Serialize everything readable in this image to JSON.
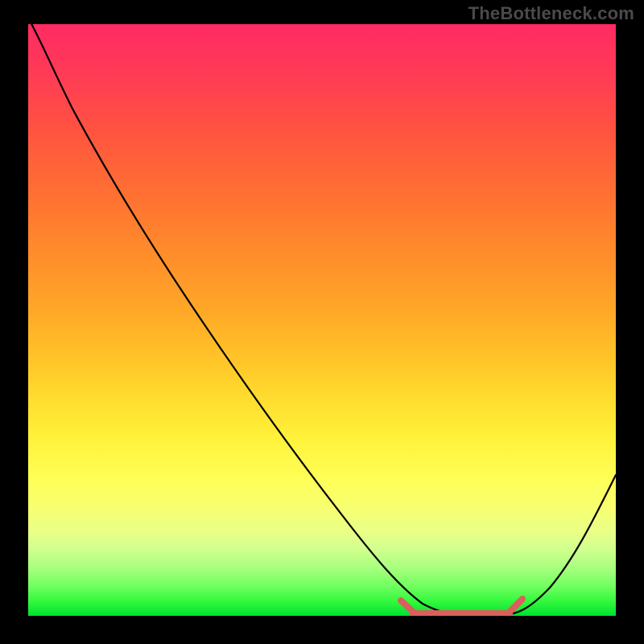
{
  "watermark": "TheBottleneck.com",
  "chart_data": {
    "type": "line",
    "title": "",
    "xlabel": "",
    "ylabel": "",
    "xlim": [
      0,
      100
    ],
    "ylim": [
      0,
      100
    ],
    "series": [
      {
        "name": "bottleneck-curve",
        "x": [
          0,
          3,
          7,
          12,
          20,
          30,
          40,
          50,
          58,
          63,
          66,
          70,
          74,
          78,
          80,
          84,
          88,
          92,
          96,
          100
        ],
        "y": [
          101,
          97,
          92,
          86,
          75,
          62,
          49,
          36,
          25,
          17,
          12,
          6,
          2,
          0,
          0,
          0,
          4,
          12,
          24,
          38
        ]
      }
    ],
    "flat_segment": {
      "name": "bottom-highlight",
      "x": [
        63,
        80
      ],
      "y": [
        0,
        0
      ],
      "color": "#d9605d"
    },
    "gradient_stops": [
      {
        "pos": 0,
        "color": "#ff2a63"
      },
      {
        "pos": 50,
        "color": "#ffa627"
      },
      {
        "pos": 75,
        "color": "#feff57"
      },
      {
        "pos": 100,
        "color": "#00e12f"
      }
    ]
  }
}
